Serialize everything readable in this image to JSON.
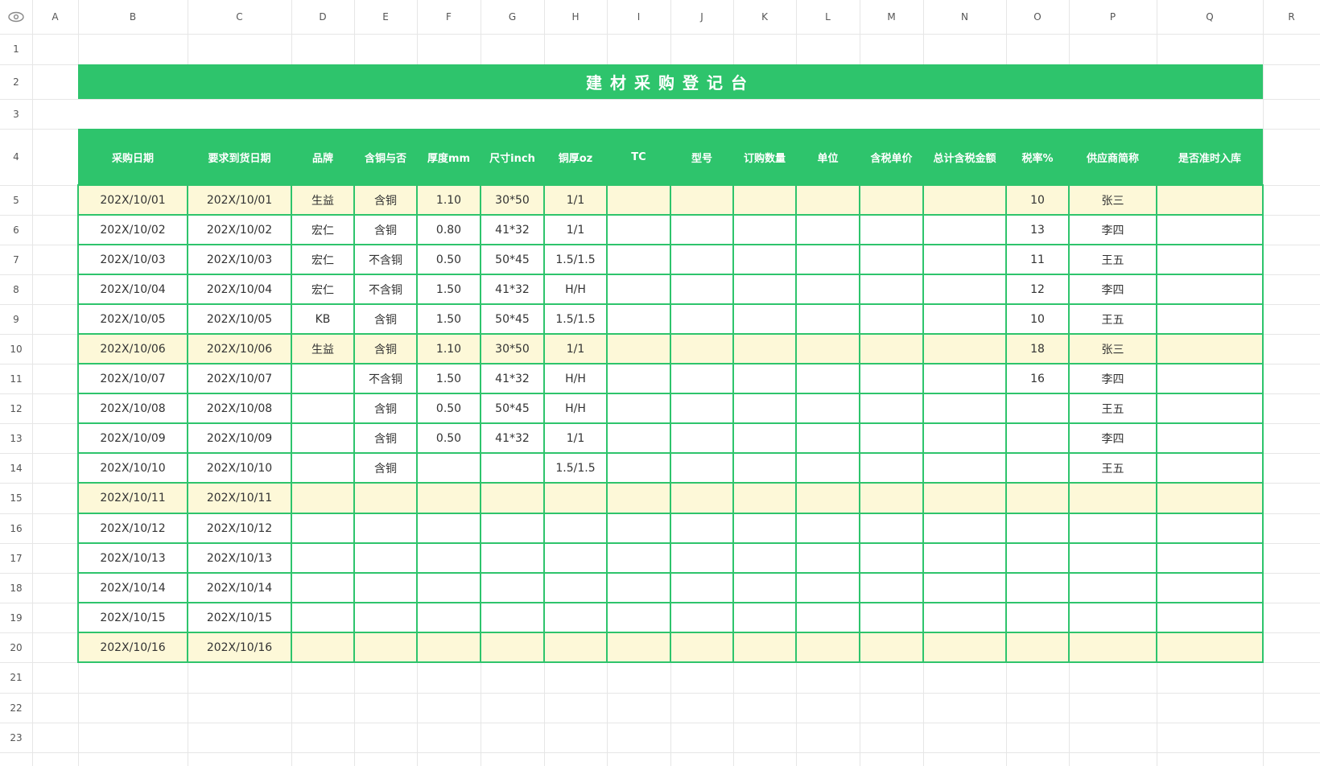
{
  "colors": {
    "header_green": "#2ec46c",
    "border_green": "#2ec46c",
    "highlight_row": "#fdf8d8",
    "grid": "#e6e6e6"
  },
  "corner_icon": "eye-icon",
  "column_headers": [
    "A",
    "B",
    "C",
    "D",
    "E",
    "F",
    "G",
    "H",
    "I",
    "J",
    "K",
    "L",
    "M",
    "N",
    "O",
    "P",
    "Q",
    "R"
  ],
  "row_numbers": [
    "1",
    "2",
    "3",
    "4",
    "5",
    "6",
    "7",
    "8",
    "9",
    "10",
    "11",
    "12",
    "13",
    "14",
    "15",
    "16",
    "17",
    "18",
    "19",
    "20",
    "21",
    "22",
    "23"
  ],
  "title": "建材采购登记台",
  "table": {
    "headers": [
      "采购日期",
      "要求到货日期",
      "品牌",
      "含铜与否",
      "厚度mm",
      "尺寸inch",
      "铜厚oz",
      "TC",
      "型号",
      "订购数量",
      "单位",
      "含税单价",
      "总计含税金额",
      "税率%",
      "供应商简称",
      "是否准时入库"
    ],
    "highlighted_rows": [
      0,
      5,
      10,
      15
    ],
    "rows": [
      [
        "202X/10/01",
        "202X/10/01",
        "生益",
        "含铜",
        "1.10",
        "30*50",
        "1/1",
        "",
        "",
        "",
        "",
        "",
        "",
        "10",
        "张三",
        ""
      ],
      [
        "202X/10/02",
        "202X/10/02",
        "宏仁",
        "含铜",
        "0.80",
        "41*32",
        "1/1",
        "",
        "",
        "",
        "",
        "",
        "",
        "13",
        "李四",
        ""
      ],
      [
        "202X/10/03",
        "202X/10/03",
        "宏仁",
        "不含铜",
        "0.50",
        "50*45",
        "1.5/1.5",
        "",
        "",
        "",
        "",
        "",
        "",
        "11",
        "王五",
        ""
      ],
      [
        "202X/10/04",
        "202X/10/04",
        "宏仁",
        "不含铜",
        "1.50",
        "41*32",
        "H/H",
        "",
        "",
        "",
        "",
        "",
        "",
        "12",
        "李四",
        ""
      ],
      [
        "202X/10/05",
        "202X/10/05",
        "KB",
        "含铜",
        "1.50",
        "50*45",
        "1.5/1.5",
        "",
        "",
        "",
        "",
        "",
        "",
        "10",
        "王五",
        ""
      ],
      [
        "202X/10/06",
        "202X/10/06",
        "生益",
        "含铜",
        "1.10",
        "30*50",
        "1/1",
        "",
        "",
        "",
        "",
        "",
        "",
        "18",
        "张三",
        ""
      ],
      [
        "202X/10/07",
        "202X/10/07",
        "",
        "不含铜",
        "1.50",
        "41*32",
        "H/H",
        "",
        "",
        "",
        "",
        "",
        "",
        "16",
        "李四",
        ""
      ],
      [
        "202X/10/08",
        "202X/10/08",
        "",
        "含铜",
        "0.50",
        "50*45",
        "H/H",
        "",
        "",
        "",
        "",
        "",
        "",
        "",
        "王五",
        ""
      ],
      [
        "202X/10/09",
        "202X/10/09",
        "",
        "含铜",
        "0.50",
        "41*32",
        "1/1",
        "",
        "",
        "",
        "",
        "",
        "",
        "",
        "李四",
        ""
      ],
      [
        "202X/10/10",
        "202X/10/10",
        "",
        "含铜",
        "",
        "",
        "1.5/1.5",
        "",
        "",
        "",
        "",
        "",
        "",
        "",
        "王五",
        ""
      ],
      [
        "202X/10/11",
        "202X/10/11",
        "",
        "",
        "",
        "",
        "",
        "",
        "",
        "",
        "",
        "",
        "",
        "",
        "",
        ""
      ],
      [
        "202X/10/12",
        "202X/10/12",
        "",
        "",
        "",
        "",
        "",
        "",
        "",
        "",
        "",
        "",
        "",
        "",
        "",
        ""
      ],
      [
        "202X/10/13",
        "202X/10/13",
        "",
        "",
        "",
        "",
        "",
        "",
        "",
        "",
        "",
        "",
        "",
        "",
        "",
        ""
      ],
      [
        "202X/10/14",
        "202X/10/14",
        "",
        "",
        "",
        "",
        "",
        "",
        "",
        "",
        "",
        "",
        "",
        "",
        "",
        ""
      ],
      [
        "202X/10/15",
        "202X/10/15",
        "",
        "",
        "",
        "",
        "",
        "",
        "",
        "",
        "",
        "",
        "",
        "",
        "",
        ""
      ],
      [
        "202X/10/16",
        "202X/10/16",
        "",
        "",
        "",
        "",
        "",
        "",
        "",
        "",
        "",
        "",
        "",
        "",
        "",
        ""
      ]
    ]
  }
}
